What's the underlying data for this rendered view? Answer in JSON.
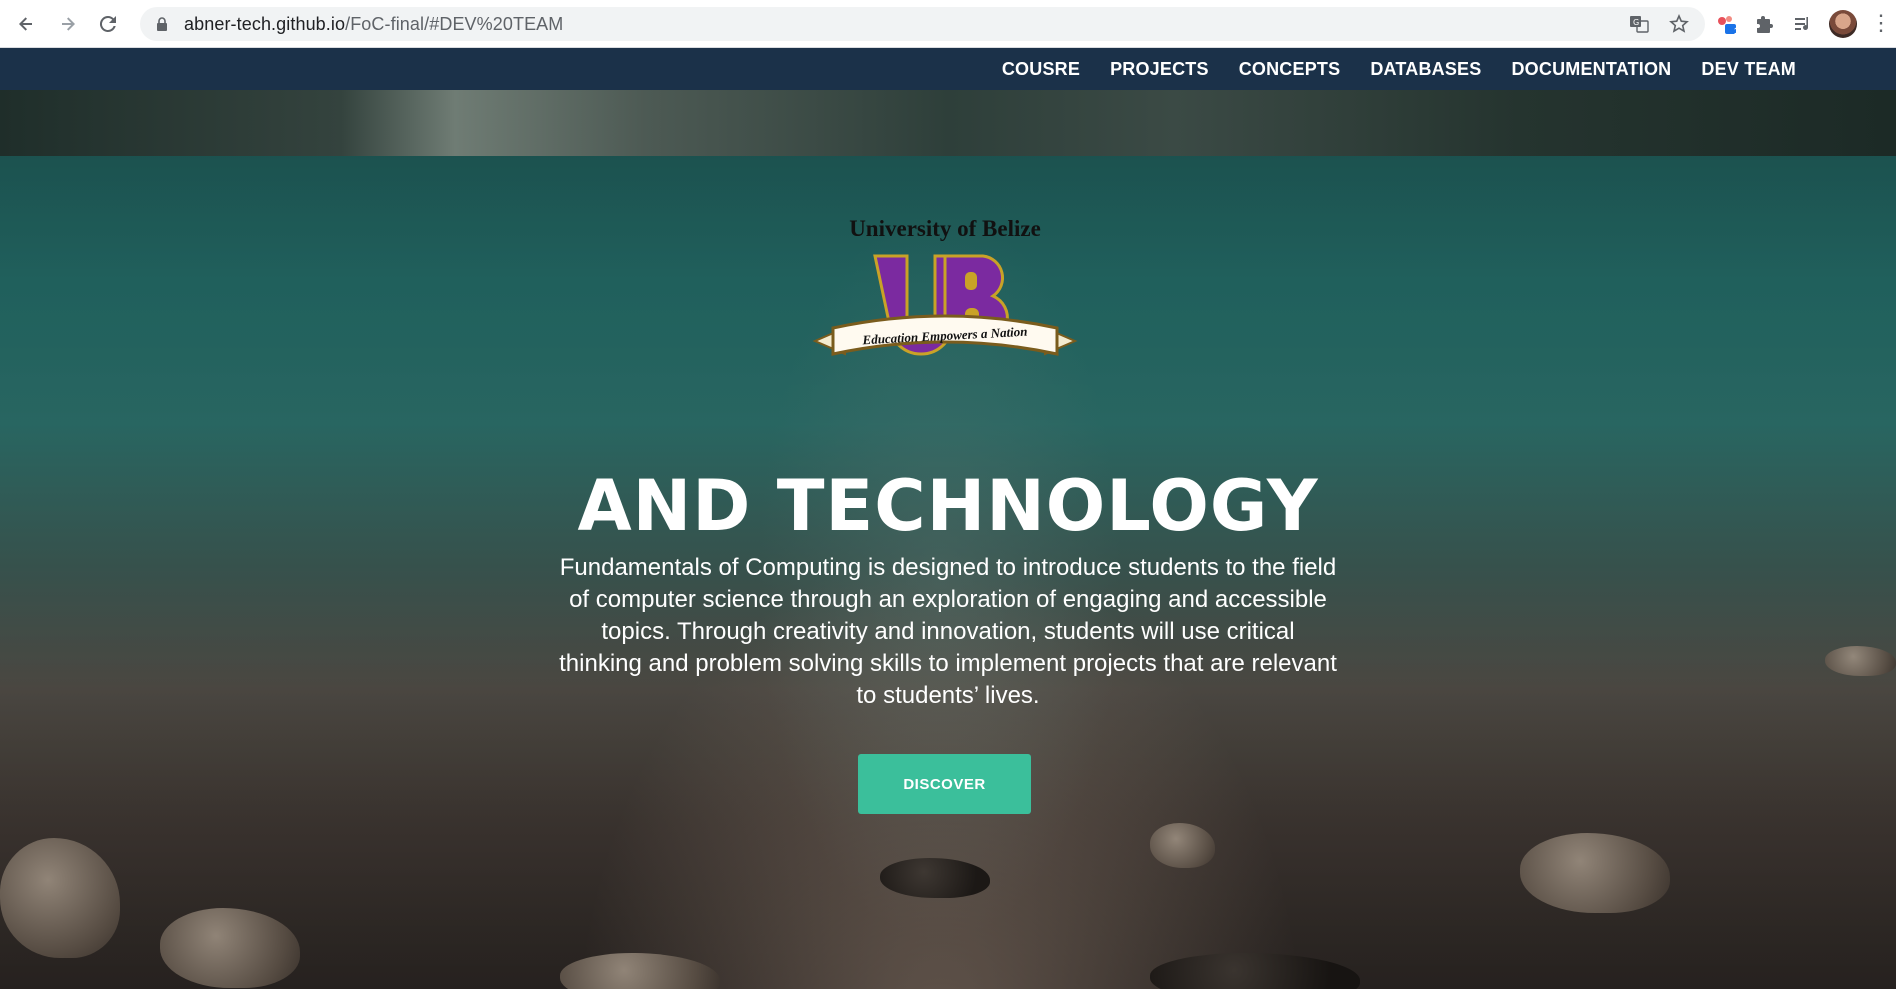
{
  "browser": {
    "url_host": "abner-tech.github.io",
    "url_path": "/FoC-final/#DEV%20TEAM",
    "back_icon": "arrow-left-icon",
    "forward_icon": "arrow-right-icon",
    "reload_icon": "reload-icon",
    "extension_badge": "1"
  },
  "nav": {
    "items": [
      {
        "label": "COUSRE"
      },
      {
        "label": "PROJECTS"
      },
      {
        "label": "CONCEPTS"
      },
      {
        "label": "DATABASES"
      },
      {
        "label": "DOCUMENTATION"
      },
      {
        "label": "DEV TEAM"
      }
    ]
  },
  "logo": {
    "title": "University of Belize",
    "letters": "UB",
    "motto": "Education Empowers a Nation"
  },
  "hero": {
    "title": "AND TECHNOLOGY",
    "description": "Fundamentals of Computing is designed to introduce students to the field of computer science through an exploration of engaging and accessible topics. Through creativity and innovation, students will use critical thinking and problem solving skills to implement projects that are relevant to students’ lives.",
    "button_label": "DISCOVER"
  },
  "colors": {
    "nav_bg": "#1b3149",
    "button_bg": "#3bbf9b",
    "logo_purple": "#7b2aa0",
    "logo_gold": "#c9a227"
  }
}
